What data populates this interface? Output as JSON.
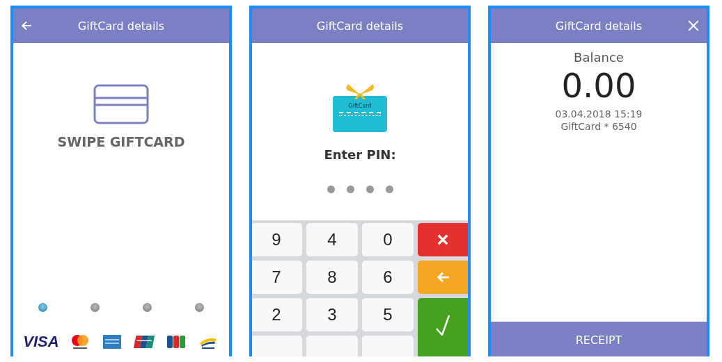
{
  "screens": [
    {
      "kind": "swipe",
      "header": {
        "title": "GiftCard details",
        "back_button": true,
        "close_button": false
      },
      "prompt": "SWIPE GIFTCARD",
      "indicators": [
        {
          "on": true
        },
        {
          "on": false
        },
        {
          "on": false
        },
        {
          "on": false
        }
      ],
      "card_logos": [
        {
          "kind": "visa",
          "label": "VISA"
        },
        {
          "kind": "mastercard"
        },
        {
          "kind": "amex"
        },
        {
          "kind": "unionpay"
        },
        {
          "kind": "jcb"
        },
        {
          "kind": "girocard"
        }
      ]
    },
    {
      "kind": "pin",
      "header": {
        "title": "GiftCard details",
        "back_button": false,
        "close_button": false
      },
      "card_label": "GiftCard",
      "prompt": "Enter PIN:",
      "pin_dots": [
        {
          "filled": false
        },
        {
          "filled": false
        },
        {
          "filled": false
        },
        {
          "filled": false
        }
      ],
      "keys": [
        {
          "kind": "digit",
          "label": "9"
        },
        {
          "kind": "digit",
          "label": "4"
        },
        {
          "kind": "digit",
          "label": "0"
        },
        {
          "kind": "cancel"
        },
        {
          "kind": "digit",
          "label": "7"
        },
        {
          "kind": "digit",
          "label": "8"
        },
        {
          "kind": "digit",
          "label": "6"
        },
        {
          "kind": "back"
        },
        {
          "kind": "digit",
          "label": "2"
        },
        {
          "kind": "digit",
          "label": "3"
        },
        {
          "kind": "digit",
          "label": "5"
        },
        {
          "kind": "ok"
        }
      ]
    },
    {
      "kind": "balance",
      "header": {
        "title": "GiftCard details",
        "back_button": false,
        "close_button": true
      },
      "balance_label": "Balance",
      "amount": "0.00",
      "date": "03.04.2018 15:19",
      "card": "GiftCard * 6540",
      "button": "RECEIPT"
    }
  ]
}
